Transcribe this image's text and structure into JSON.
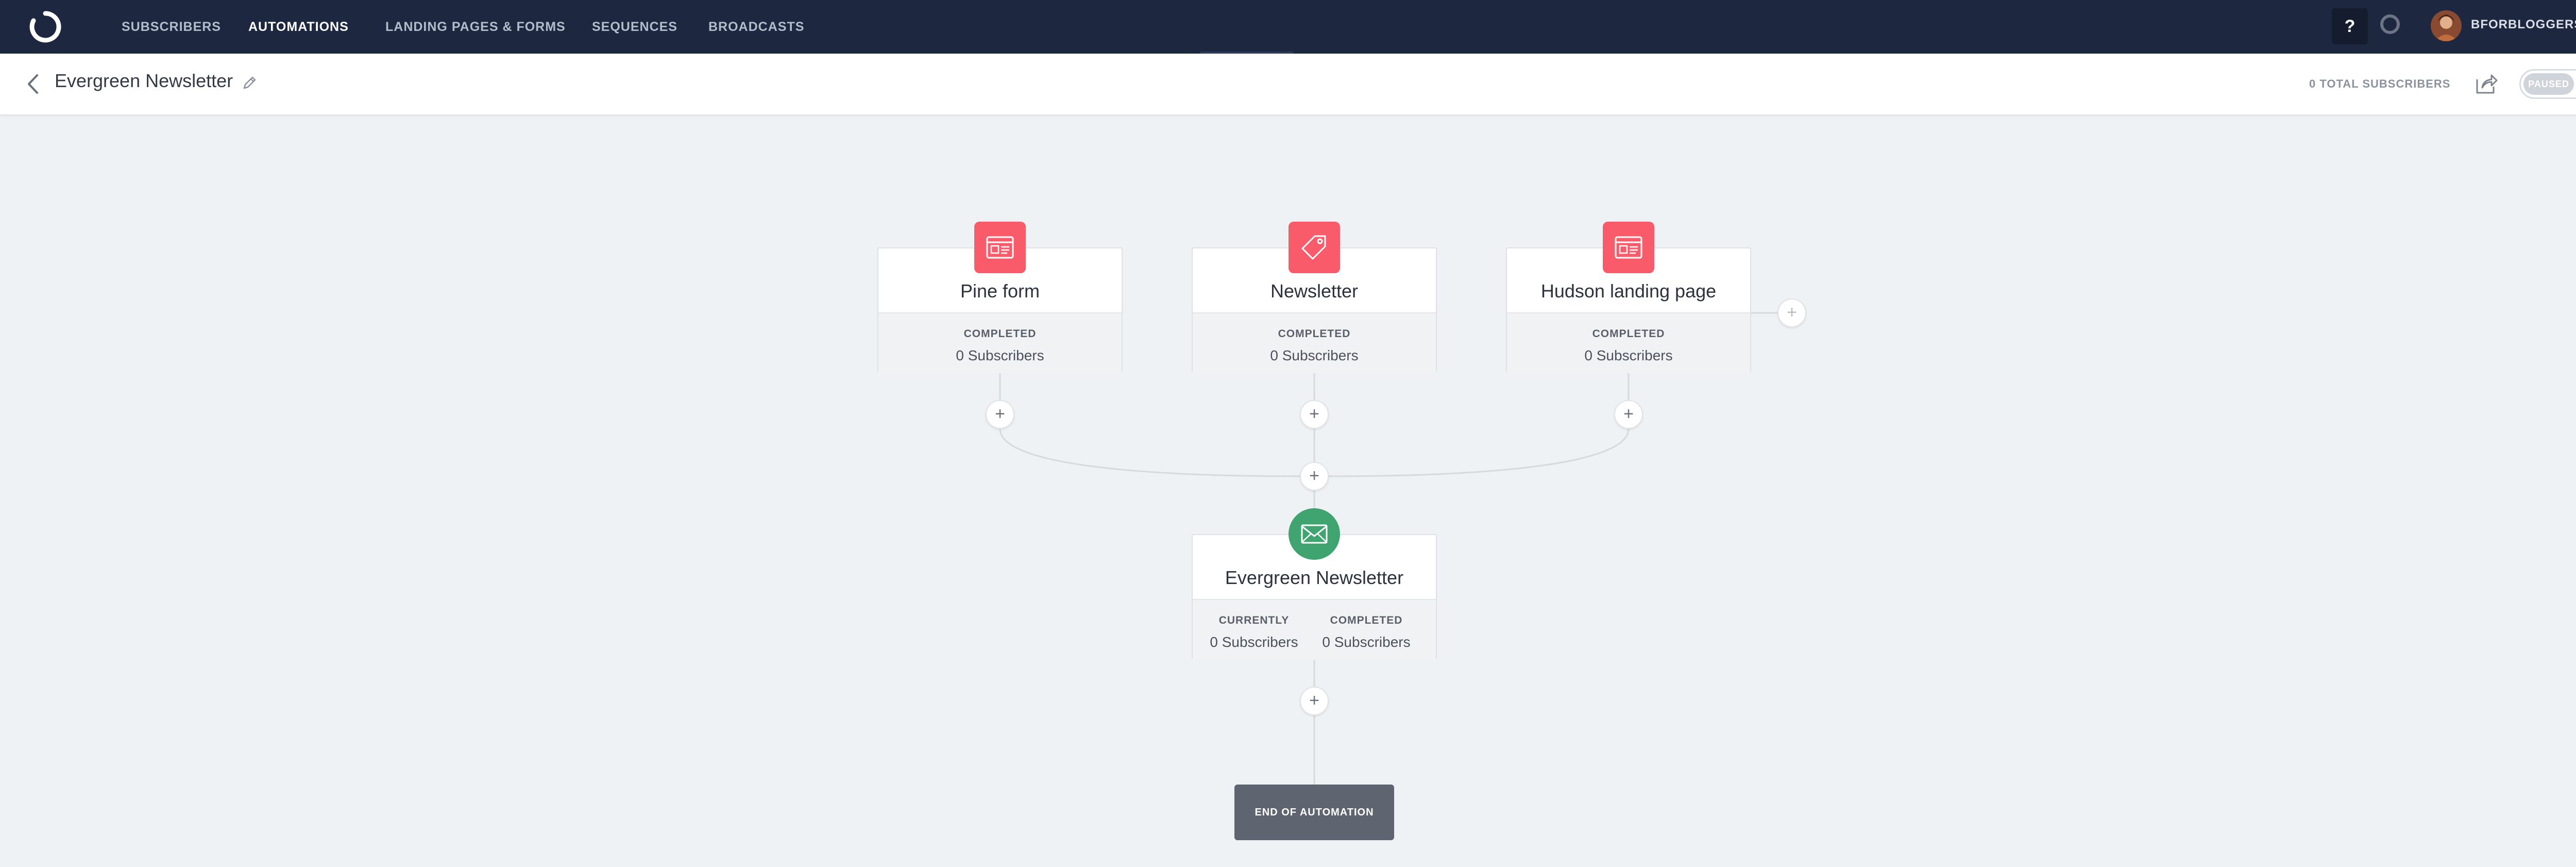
{
  "nav": {
    "items": [
      {
        "label": "SUBSCRIBERS"
      },
      {
        "label": "AUTOMATIONS"
      },
      {
        "label": "LANDING PAGES & FORMS"
      },
      {
        "label": "SEQUENCES"
      },
      {
        "label": "BROADCASTS"
      }
    ],
    "active": "AUTOMATIONS",
    "help_label": "?",
    "account_name": "BFORBLOGGERS"
  },
  "header": {
    "title": "Evergreen Newsletter",
    "total_subscribers": "0 TOTAL SUBSCRIBERS",
    "status_toggle": "PAUSED"
  },
  "entry_points": [
    {
      "name": "Pine form",
      "icon": "form-icon",
      "stat_label": "COMPLETED",
      "stat_value": "0 Subscribers"
    },
    {
      "name": "Newsletter",
      "icon": "tag-icon",
      "stat_label": "COMPLETED",
      "stat_value": "0 Subscribers"
    },
    {
      "name": "Hudson landing page",
      "icon": "landing-page-icon",
      "stat_label": "COMPLETED",
      "stat_value": "0 Subscribers"
    }
  ],
  "sequence_node": {
    "name": "Evergreen Newsletter",
    "icon": "envelope-icon",
    "currently_label": "CURRENTLY",
    "currently_value": "0 Subscribers",
    "completed_label": "COMPLETED",
    "completed_value": "0 Subscribers"
  },
  "plus_label": "+",
  "end_label": "END OF AUTOMATION",
  "colors": {
    "nav_bg": "#1d2840",
    "canvas_bg": "#eff2f5",
    "entry_icon": "#f95b6a",
    "sequence_icon": "#3fa46f",
    "end_box": "#5e6570"
  }
}
